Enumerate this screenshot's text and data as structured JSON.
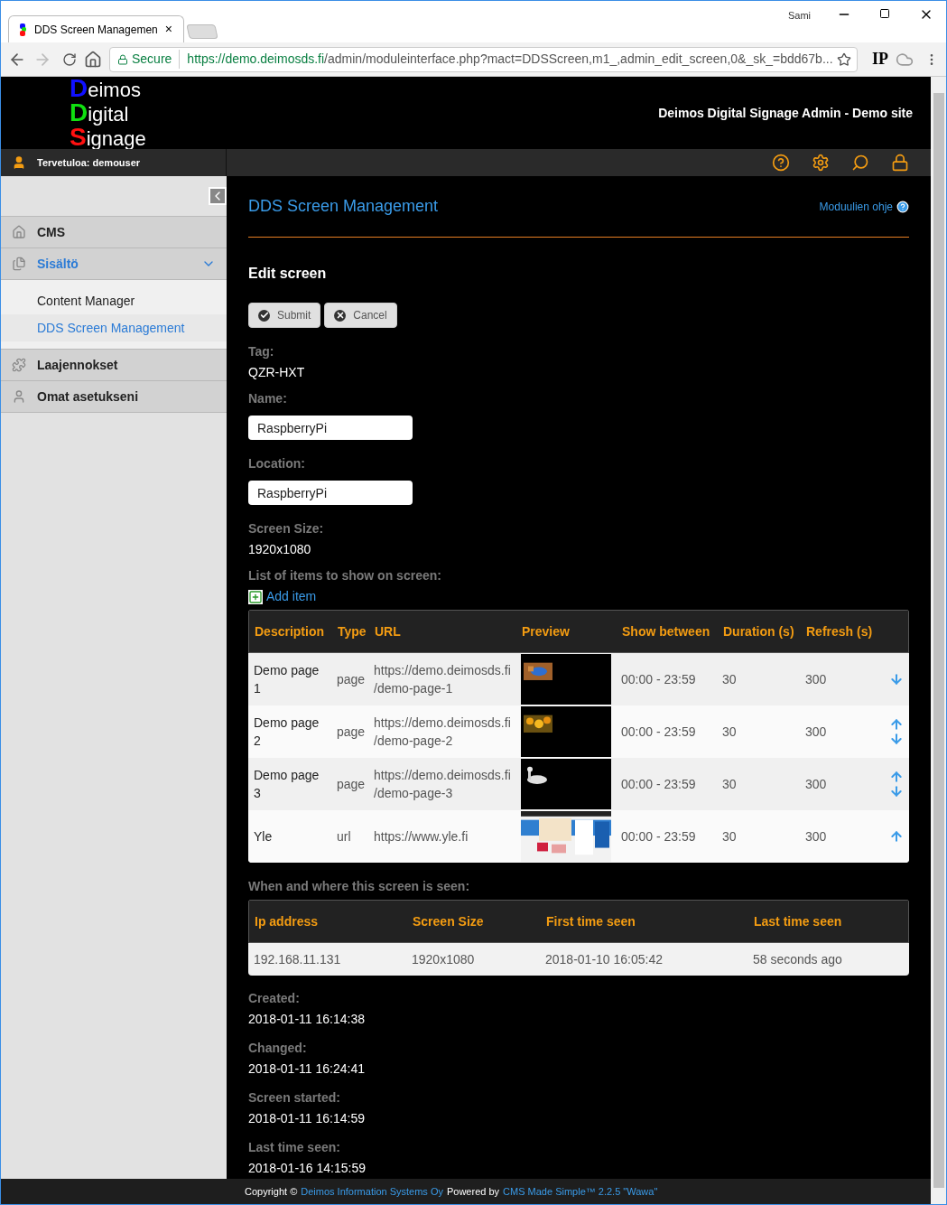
{
  "browser": {
    "tab_title": "DDS Screen Managemen",
    "close": "×",
    "user": "Sami",
    "secure_label": "Secure",
    "url_host": "https://demo.deimosds.fi",
    "url_path": "/admin/moduleinterface.php?mact=DDSScreen,m1_,admin_edit_screen,0&_sk_=bdd67b...",
    "ext_label": "IP"
  },
  "header": {
    "logo": [
      {
        "initial": "D",
        "rest": "eimos",
        "color": "#1010ff"
      },
      {
        "initial": "D",
        "rest": "igital",
        "color": "#10e010"
      },
      {
        "initial": "S",
        "rest": "ignage",
        "color": "#ff1010"
      }
    ],
    "site_title": "Deimos Digital Signage Admin - Demo site",
    "welcome": "Tervetuloa: demouser"
  },
  "sidebar": {
    "items": [
      {
        "label": "CMS",
        "selected": false,
        "expanded": false
      },
      {
        "label": "Sisältö",
        "selected": true,
        "expanded": true,
        "children": [
          {
            "label": "Content Manager",
            "selected": false
          },
          {
            "label": "DDS Screen Management",
            "selected": true
          }
        ]
      },
      {
        "label": "Laajennokset",
        "selected": false,
        "expanded": false
      },
      {
        "label": "Omat asetukseni",
        "selected": false,
        "expanded": false
      }
    ]
  },
  "page": {
    "title": "DDS Screen Management",
    "help_link": "Moduulien ohje",
    "heading": "Edit screen",
    "buttons": [
      {
        "label": "Submit",
        "kind": "submit"
      },
      {
        "label": "Cancel",
        "kind": "cancel"
      }
    ],
    "tag_label": "Tag:",
    "tag": "QZR-HXT",
    "name_label": "Name:",
    "name": "RaspberryPi",
    "location_label": "Location:",
    "location": "RaspberryPi",
    "size_label": "Screen Size:",
    "size": "1920x1080",
    "items_label": "List of items to show on screen:",
    "add_item": "Add item",
    "items_columns": [
      "Description",
      "Type",
      "URL",
      "Preview",
      "Show between",
      "Duration (s)",
      "Refresh (s)"
    ],
    "items": [
      {
        "description": "Demo page 1",
        "type": "page",
        "url": "https://demo.deimosds.fi /demo-page-1",
        "show_between": "00:00 - 23:59",
        "duration": "30",
        "refresh": "300",
        "can_move_up": false,
        "can_move_down": true
      },
      {
        "description": "Demo page 2",
        "type": "page",
        "url": "https://demo.deimosds.fi /demo-page-2",
        "show_between": "00:00 - 23:59",
        "duration": "30",
        "refresh": "300",
        "can_move_up": true,
        "can_move_down": true
      },
      {
        "description": "Demo page 3",
        "type": "page",
        "url": "https://demo.deimosds.fi /demo-page-3",
        "show_between": "00:00 - 23:59",
        "duration": "30",
        "refresh": "300",
        "can_move_up": true,
        "can_move_down": true
      },
      {
        "description": "Yle",
        "type": "url",
        "url": "https://www.yle.fi",
        "show_between": "00:00 - 23:59",
        "duration": "30",
        "refresh": "300",
        "can_move_up": true,
        "can_move_down": false
      }
    ],
    "seen_label": "When and where this screen is seen:",
    "seen_columns": [
      "Ip address",
      "Screen Size",
      "First time seen",
      "Last time seen"
    ],
    "seen_rows": [
      [
        "192.168.11.131",
        "1920x1080",
        "2018-01-10 16:05:42",
        "58 seconds ago"
      ]
    ],
    "facts": [
      {
        "label": "Created:",
        "value": "2018-01-11 16:14:38"
      },
      {
        "label": "Changed:",
        "value": "2018-01-11 16:24:41"
      },
      {
        "label": "Screen started:",
        "value": "2018-01-11 16:14:59"
      },
      {
        "label": "Last time seen:",
        "value": "2018-01-16 14:15:59"
      }
    ]
  },
  "footer": {
    "copyright": "Copyright ©",
    "company": "Deimos Information Systems Oy",
    "powered": "Powered by",
    "cms": "CMS Made Simple™ 2.2.5 \"Wawa\""
  }
}
